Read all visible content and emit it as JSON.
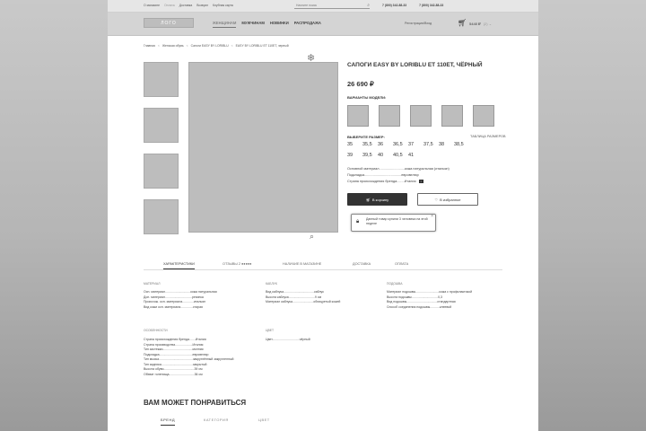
{
  "topbar": {
    "links": [
      "О магазине",
      "Оплата",
      "Доставка",
      "Возврат",
      "Клубная карта"
    ],
    "search_placeholder": "Начните поиск",
    "phones": [
      "7 (800) 342-88-33",
      "7 (800) 342-88-33"
    ]
  },
  "header": {
    "logo": "ЛОГО",
    "nav": [
      "ЖЕНЩИНАМ",
      "МУЖЧИНАМ",
      "НОВИНКИ",
      "РАСПРОДАЖА"
    ],
    "login": "Регистрация/Вход",
    "cart_total": "5440 ₽",
    "cart_count": "(2) ⌄"
  },
  "breadcrumb": [
    "Главная",
    "Женская обувь",
    "Сапоги EASY BY LORIBLU",
    "EASY BY LORIBLU ET 110ET, черный"
  ],
  "product": {
    "title": "Сапоги EASY BY LORIBLU ET 110ET, чёрный",
    "price": "26 690 ₽",
    "variants_label": "ВАРИАНТЫ МОДЕЛИ:",
    "size_label": "ВЫБЕРИТЕ РАЗМЕР:",
    "size_chart": "ТАБЛИЦА РАЗМЕРОВ",
    "sizes_row1": [
      "35",
      "35,5",
      "36",
      "36,5",
      "37",
      "37,5",
      "38",
      "38,5"
    ],
    "sizes_row2": [
      "39",
      "39,5",
      "40",
      "40,5",
      "41"
    ],
    "specs": [
      "Основной материал...........................кожа натуральная (итальян)",
      "Подкладка.......................................евровелюр",
      "Страна происхождения бренда........Италия"
    ],
    "add_to_cart": "В корзину",
    "add_to_fav": "В избранное",
    "tooltip": "Данный товар купили 3 человека на этой неделе"
  },
  "tabs": {
    "items": [
      "ХАРАКТЕРИСТИКИ",
      "ОТЗЫВЫ 2 ●●●●●",
      "НАЛИЧИЕ В МАГАЗИНЕ",
      "ДОСТАВКА",
      "ОПЛАТА"
    ]
  },
  "characteristics": {
    "material": {
      "title": "МАТЕРИАЛ",
      "rows": [
        "Осн. материал.............................кожа натуральная",
        "Доп. материал...............................резинка",
        "Происхож. осн. материала.............итальян",
        "Вид кожи осн. материала..............старая"
      ]
    },
    "heel": {
      "title": "КАБЛУК",
      "rows": [
        "Вид каблука...................................каблук",
        "Высота каблука..............................9 см",
        "Материал каблука........................облицуетый кожей"
      ]
    },
    "sole": {
      "title": "ПОДОШВА",
      "rows": [
        "Материал подошвы...........................кожа с профилактикой",
        "Высота подошвы..............................0,3",
        "Вид подошвы...................................стандартная",
        "Способ соединения подошвы...........клеевой"
      ]
    },
    "features": {
      "title": "ОСОБЕННОСТИ",
      "rows": [
        "Страна происхождения бренда.......Италия",
        "Страна производства....................Италия",
        "Тип застежки..................................молния",
        "Подкладка......................................евровелюр",
        "Тип мыска.......................................закруглённый закругленный",
        "Тип задника....................................закрытый",
        "Высота обуви...................................39 см",
        "Обхват голенища.............................36 см"
      ]
    },
    "color": {
      "title": "ЦВЕТ",
      "rows": [
        "Цвет...............................чёрный"
      ]
    }
  },
  "recommend": {
    "title": "ВАМ МОЖЕТ ПОНРАВИТЬСЯ",
    "tabs": [
      "БРЕНД",
      "КАТЕГОРИЯ",
      "ЦВЕТ"
    ]
  }
}
